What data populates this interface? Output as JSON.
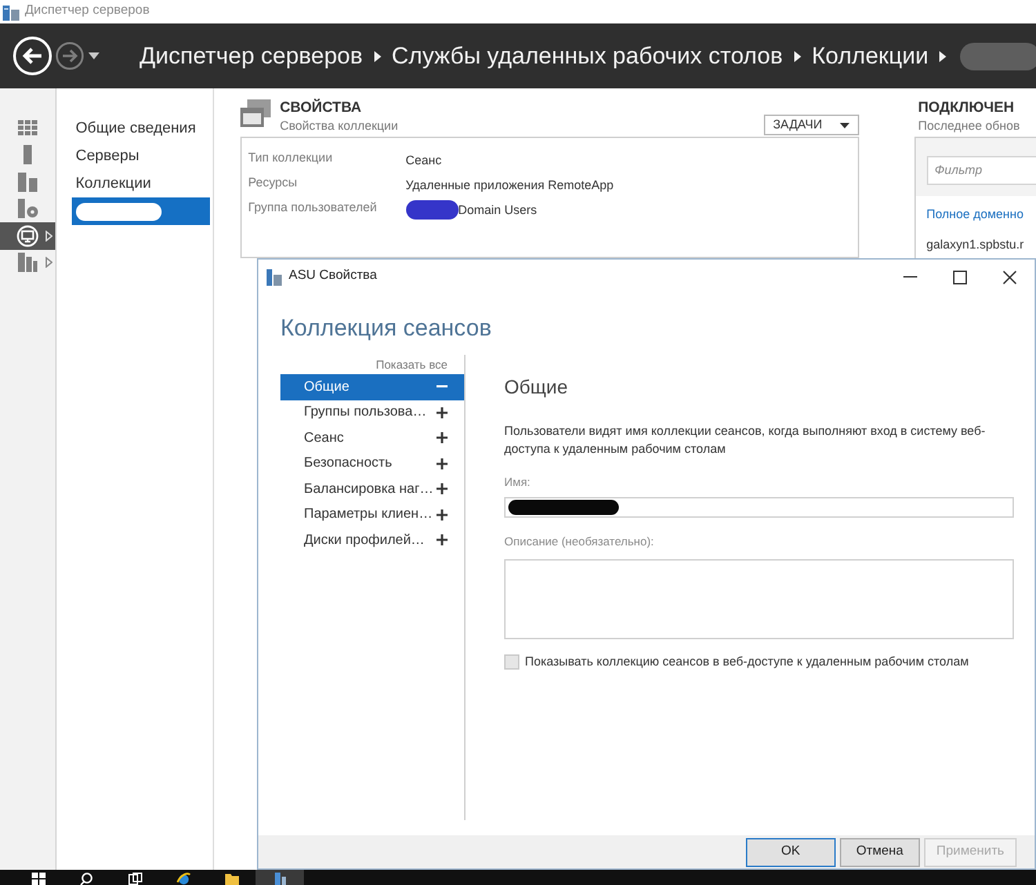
{
  "window": {
    "title": "Диспетчер серверов"
  },
  "header": {
    "back_disabled": false,
    "forward_disabled": true,
    "breadcrumb": [
      {
        "kind": "text",
        "label": "Диспетчер серверов"
      },
      {
        "kind": "text",
        "label": "Службы удаленных рабочих столов"
      },
      {
        "kind": "text",
        "label": "Коллекции"
      },
      {
        "kind": "redacted"
      }
    ]
  },
  "rail": {
    "items": [
      {
        "kind": "dashboard",
        "selected": false,
        "expandable": false
      },
      {
        "kind": "server",
        "selected": false,
        "expandable": false
      },
      {
        "kind": "servers",
        "selected": false,
        "expandable": false
      },
      {
        "kind": "storage",
        "selected": false,
        "expandable": false
      },
      {
        "kind": "remote",
        "selected": true,
        "expandable": true
      },
      {
        "kind": "group",
        "selected": false,
        "expandable": true
      }
    ]
  },
  "nav": {
    "items": [
      {
        "kind": "text",
        "label": "Общие сведения",
        "selected": false
      },
      {
        "kind": "text",
        "label": "Серверы",
        "selected": false
      },
      {
        "kind": "text",
        "label": "Коллекции",
        "selected": false
      },
      {
        "kind": "redacted",
        "selected": true
      }
    ]
  },
  "properties": {
    "title": "СВОЙСТВА",
    "subtitle": "Свойства коллекции",
    "tasks_button": "ЗАДАЧИ",
    "rows": [
      {
        "label": "Тип коллекции",
        "value": "Сеанс",
        "redacted": false
      },
      {
        "label": "Ресурсы",
        "value": "Удаленные приложения RemoteApp",
        "redacted": false
      },
      {
        "label": "Группа пользователей",
        "value": "Domain Users",
        "redacted": true
      }
    ]
  },
  "connections": {
    "title": "ПОДКЛЮЧЕН",
    "subtitle": "Последнее обнов",
    "filter": {
      "placeholder": "Фильтр"
    },
    "columns": [
      "Полное доменно"
    ],
    "rows": [
      "galaxyn1.spbstu.r"
    ]
  },
  "dialog": {
    "title": "ASU Свойства",
    "heading": "Коллекция сеансов",
    "show_all": "Показать все",
    "sections": [
      {
        "label": "Общие",
        "selected": true,
        "expanded": true
      },
      {
        "label": "Группы пользова…",
        "selected": false,
        "expanded": false
      },
      {
        "label": "Сеанс",
        "selected": false,
        "expanded": false
      },
      {
        "label": "Безопасность",
        "selected": false,
        "expanded": false
      },
      {
        "label": "Балансировка наг…",
        "selected": false,
        "expanded": false
      },
      {
        "label": "Параметры клиен…",
        "selected": false,
        "expanded": false
      },
      {
        "label": "Диски профилей…",
        "selected": false,
        "expanded": false
      }
    ],
    "section_title": "Общие",
    "intro": "Пользователи видят имя коллекции сеансов, когда выполняют вход в систему веб-доступа к удаленным рабочим столам",
    "name": {
      "label": "Имя:",
      "redacted": true
    },
    "description": {
      "label": "Описание (необязательно):"
    },
    "web_access": {
      "label": "Показывать коллекцию сеансов в веб-доступе к удаленным рабочим столам",
      "checked": false
    },
    "buttons": [
      {
        "label": "OK",
        "default": true,
        "disabled": false
      },
      {
        "label": "Отмена",
        "default": false,
        "disabled": false
      },
      {
        "label": "Применить",
        "default": false,
        "disabled": true
      }
    ]
  },
  "taskbar": {
    "items": [
      {
        "kind": "start",
        "selected": false
      },
      {
        "kind": "search",
        "selected": false
      },
      {
        "kind": "task-view",
        "selected": false
      },
      {
        "kind": "browser",
        "selected": false
      },
      {
        "kind": "folder",
        "selected": false
      },
      {
        "kind": "server-manager",
        "selected": true
      }
    ]
  }
}
